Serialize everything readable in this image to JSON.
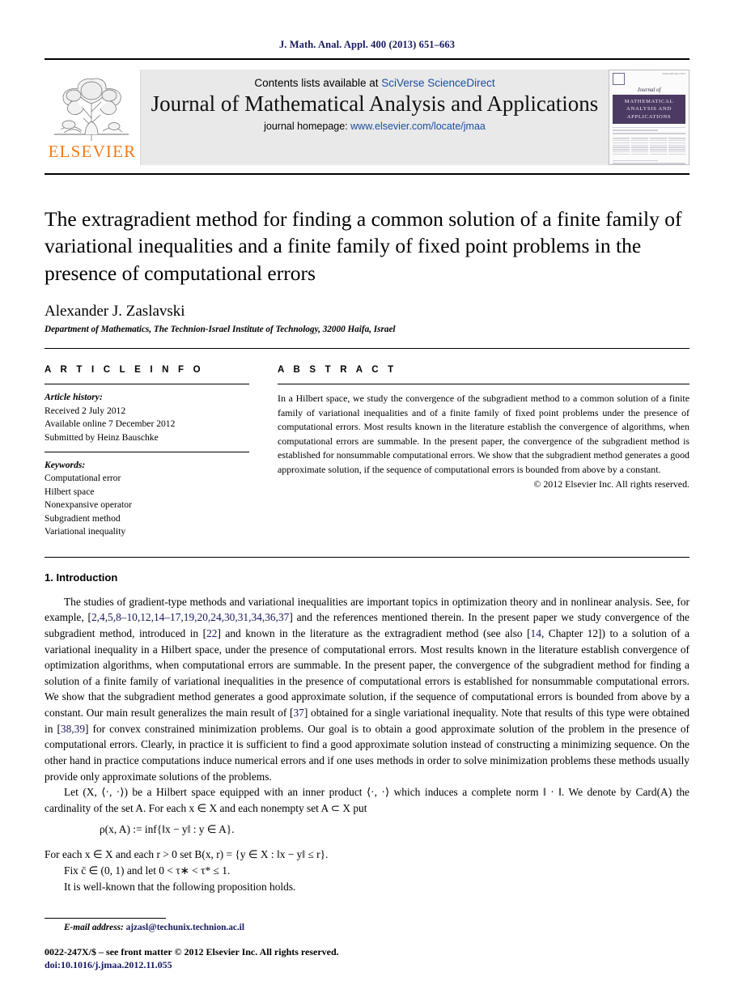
{
  "running_head": "J. Math. Anal. Appl. 400 (2013) 651–663",
  "masthead": {
    "publisher_name": "ELSEVIER",
    "contents_prefix": "Contents lists available at ",
    "contents_link": "SciVerse ScienceDirect",
    "journal_title": "Journal of Mathematical Analysis and Applications",
    "homepage_prefix": "journal homepage: ",
    "homepage_url": "www.elsevier.com/locate/jmaa",
    "cover": {
      "script_word": "Journal of",
      "title_line1": "MATHEMATICAL",
      "title_line2": "ANALYSIS AND",
      "title_line3": "APPLICATIONS"
    },
    "colors": {
      "link_blue": "#1b4ea0",
      "elsevier_orange": "#f07c1a",
      "masthead_gray": "#e9e9e9",
      "cover_purple": "#4b3b63"
    }
  },
  "article": {
    "title": "The extragradient method for finding a common solution of a finite family of variational inequalities and a finite family of fixed point problems in the presence of computational errors",
    "author": "Alexander J. Zaslavski",
    "affiliation": "Department of Mathematics, The Technion-Israel Institute of Technology, 32000 Haifa, Israel"
  },
  "article_info": {
    "heading": "A R T I C L E   I N F O",
    "history_label": "Article history:",
    "received": "Received 2 July 2012",
    "available_online": "Available online 7 December 2012",
    "submitted_by": "Submitted by Heinz Bauschke",
    "keywords_label": "Keywords:",
    "keywords": [
      "Computational error",
      "Hilbert space",
      "Nonexpansive operator",
      "Subgradient method",
      "Variational inequality"
    ]
  },
  "abstract": {
    "heading": "A B S T R A C T",
    "text": "In a Hilbert space, we study the convergence of the subgradient method to a common solution of a finite family of variational inequalities and of a finite family of fixed point problems under the presence of computational errors. Most results known in the literature establish the convergence of algorithms, when computational errors are summable. In the present paper, the convergence of the subgradient method is established for nonsummable computational errors. We show that the subgradient method generates a good approximate solution, if the sequence of computational errors is bounded from above by a constant.",
    "copyright": "© 2012 Elsevier Inc. All rights reserved."
  },
  "introduction": {
    "heading": "1. Introduction",
    "para1_a": "The studies of gradient-type methods and variational inequalities are important topics in optimization theory and in nonlinear analysis. See, for example, [",
    "para1_cites1": "2,4,5,8–10,12,14–17,19,20,24,30,31,34,36,37",
    "para1_b": "] and the references mentioned therein. In the present paper we study convergence of the subgradient method, introduced in [",
    "para1_cite2": "22",
    "para1_c": "] and known in the literature as the extragradient method (see also [",
    "para1_cite3": "14",
    "para1_d": ", Chapter 12]) to a solution of a variational inequality in a Hilbert space, under the presence of computational errors. Most results known in the literature establish convergence of optimization algorithms, when computational errors are summable. In the present paper, the convergence of the subgradient method for finding a solution of a finite family of variational inequalities in the presence of computational errors is established for nonsummable computational errors. We show that the subgradient method generates a good approximate solution, if the sequence of computational errors is bounded from above by a constant. Our main result generalizes the main result of [",
    "para1_cite4": "37",
    "para1_e": "] obtained for a single variational inequality. Note that results of this type were obtained in [",
    "para1_cite5": "38,39",
    "para1_f": "] for convex constrained minimization problems. Our goal is to obtain a good approximate solution of the problem in the presence of computational errors. Clearly, in practice it is sufficient to find a good approximate solution instead of constructing a minimizing sequence. On the other hand in practice computations induce numerical errors and if one uses methods in order to solve minimization problems these methods usually provide only approximate solutions of the problems.",
    "para2": "Let (X, ⟨·, ·⟩) be a Hilbert space equipped with an inner product ⟨·, ·⟩ which induces a complete norm ‖ · ‖. We denote by Card(A) the cardinality of the set A. For each x ∈ X and each nonempty set A ⊂ X put",
    "formula1": "ρ(x, A) := inf{‖x − y‖ : y ∈ A}.",
    "line_each_r": "For each x ∈ X and each r > 0 set B(x, r) = {y ∈ X : ‖x − y‖ ≤ r}.",
    "line_fix_c": "Fix c̄ ∈ (0, 1) and let 0 < τ∗ < τ* ≤ 1.",
    "line_wellknown": "It is well-known that the following proposition holds."
  },
  "footer": {
    "email_label": "E-mail address:",
    "email": "ajzasl@techunix.technion.ac.il",
    "issn_line": "0022-247X/$ – see front matter © 2012 Elsevier Inc. All rights reserved.",
    "doi_line": "doi:10.1016/j.jmaa.2012.11.055"
  }
}
